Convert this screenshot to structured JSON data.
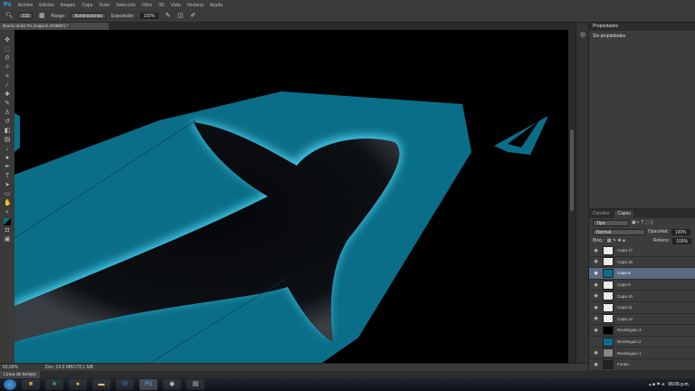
{
  "app": {
    "logo": "Ps"
  },
  "menu": [
    "Archivo",
    "Edición",
    "Imagen",
    "Capa",
    "Texto",
    "Selección",
    "Filtro",
    "3D",
    "Vista",
    "Ventana",
    "Ayuda"
  ],
  "options": {
    "range_label": "Rango:",
    "range_value": "Iluminaciones",
    "exposure_label": "Exposición:",
    "exposure_value": "100%",
    "brush_size": "133"
  },
  "document_tab": "tiburon al 63,7% (Capa 8, RGB/8*) *",
  "properties": {
    "tab": "Propiedades",
    "content": "Sin propiedades"
  },
  "layers_panel": {
    "tabs": [
      "Canales",
      "Capas"
    ],
    "filter": "Tipo",
    "blend_mode": "Normal",
    "opacity_label": "Opacidad:",
    "opacity": "100%",
    "lock_label": "Bloq.:",
    "fill_label": "Relleno:",
    "fill": "100%",
    "layers": [
      {
        "name": "Capa 17",
        "active": false,
        "visible": true
      },
      {
        "name": "Capa 16",
        "active": false,
        "visible": true
      },
      {
        "name": "Capa 8",
        "active": true,
        "visible": true
      },
      {
        "name": "Capa 9",
        "active": false,
        "visible": true
      },
      {
        "name": "Capa 10",
        "active": false,
        "visible": true
      },
      {
        "name": "Capa 11",
        "active": false,
        "visible": true
      },
      {
        "name": "Capa 12",
        "active": false,
        "visible": true
      },
      {
        "name": "Rectángulo 3",
        "active": false,
        "visible": true
      },
      {
        "name": "Rectángulo 2",
        "active": false,
        "visible": false
      },
      {
        "name": "Rectángulo 1",
        "active": false,
        "visible": true
      },
      {
        "name": "Fondo",
        "active": false,
        "visible": true
      }
    ]
  },
  "status": {
    "zoom": "63,66%",
    "doc": "Doc: 24,9 MB/178,1 MB"
  },
  "timeline": "Línea de tiempo",
  "taskbar": {
    "clock": "06:05 p.m."
  },
  "colors": {
    "teal": "#0b6e88",
    "glow": "#4fd3f3"
  }
}
